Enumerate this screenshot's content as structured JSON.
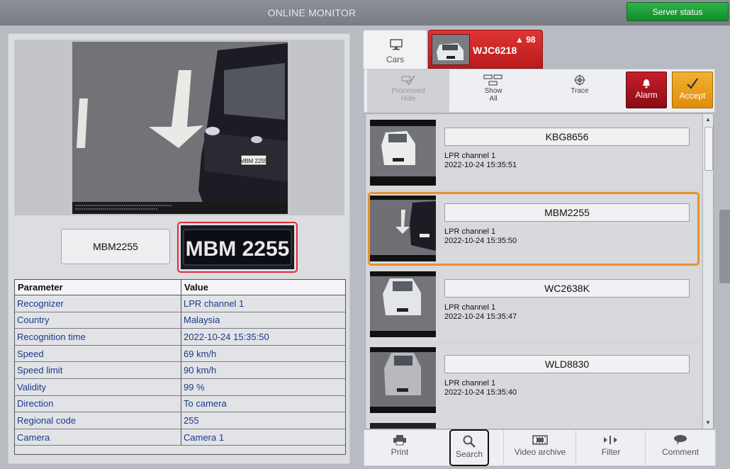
{
  "header": {
    "title": "ONLINE MONITOR",
    "server_status_label": "Server status"
  },
  "detail": {
    "plate_text": "MBM2255",
    "plate_crop_text": "MBM 2255",
    "snapshot_plate_text": "MBM 2255",
    "table": {
      "columns": [
        "Parameter",
        "Value"
      ],
      "rows": [
        {
          "param": "Recognizer",
          "value": "LPR channel  1"
        },
        {
          "param": "Country",
          "value": "Malaysia"
        },
        {
          "param": "Recognition time",
          "value": "2022-10-24 15:35:50"
        },
        {
          "param": "Speed",
          "value": "69 km/h"
        },
        {
          "param": "Speed limit",
          "value": "90 km/h"
        },
        {
          "param": "Validity",
          "value": "99 %"
        },
        {
          "param": "Direction",
          "value": "To camera"
        },
        {
          "param": "Regional code",
          "value": "255"
        },
        {
          "param": "Camera",
          "value": "Camera 1"
        }
      ]
    }
  },
  "tabs": {
    "cars_label": "Cars",
    "alarm_plate": "WJC6218",
    "alarm_count": "98"
  },
  "toolbar": {
    "processed_label_1": "Processed",
    "processed_label_2": "Hide",
    "show_label_1": "Show",
    "show_label_2": "All",
    "trace_label": "Trace",
    "alarm_label": "Alarm",
    "accept_label": "Accept"
  },
  "list": {
    "items": [
      {
        "plate": "KBG8656",
        "channel": "LPR channel  1",
        "time": "2022-10-24 15:35:51"
      },
      {
        "plate": "MBM2255",
        "channel": "LPR channel  1",
        "time": "2022-10-24 15:35:50"
      },
      {
        "plate": "WC2638K",
        "channel": "LPR channel  1",
        "time": "2022-10-24 15:35:47"
      },
      {
        "plate": "WLD8830",
        "channel": "LPR channel  1",
        "time": "2022-10-24 15:35:40"
      }
    ]
  },
  "bottom": {
    "print_label": "Print",
    "search_label": "Search",
    "video_label": "Video archive",
    "filter_label": "Filter",
    "comment_label": "Comment"
  },
  "colors": {
    "server_status": "#1f9e3a",
    "alarm_tab": "#d22a2a",
    "selected_border": "#e8912b",
    "accept": "#eea01e"
  }
}
